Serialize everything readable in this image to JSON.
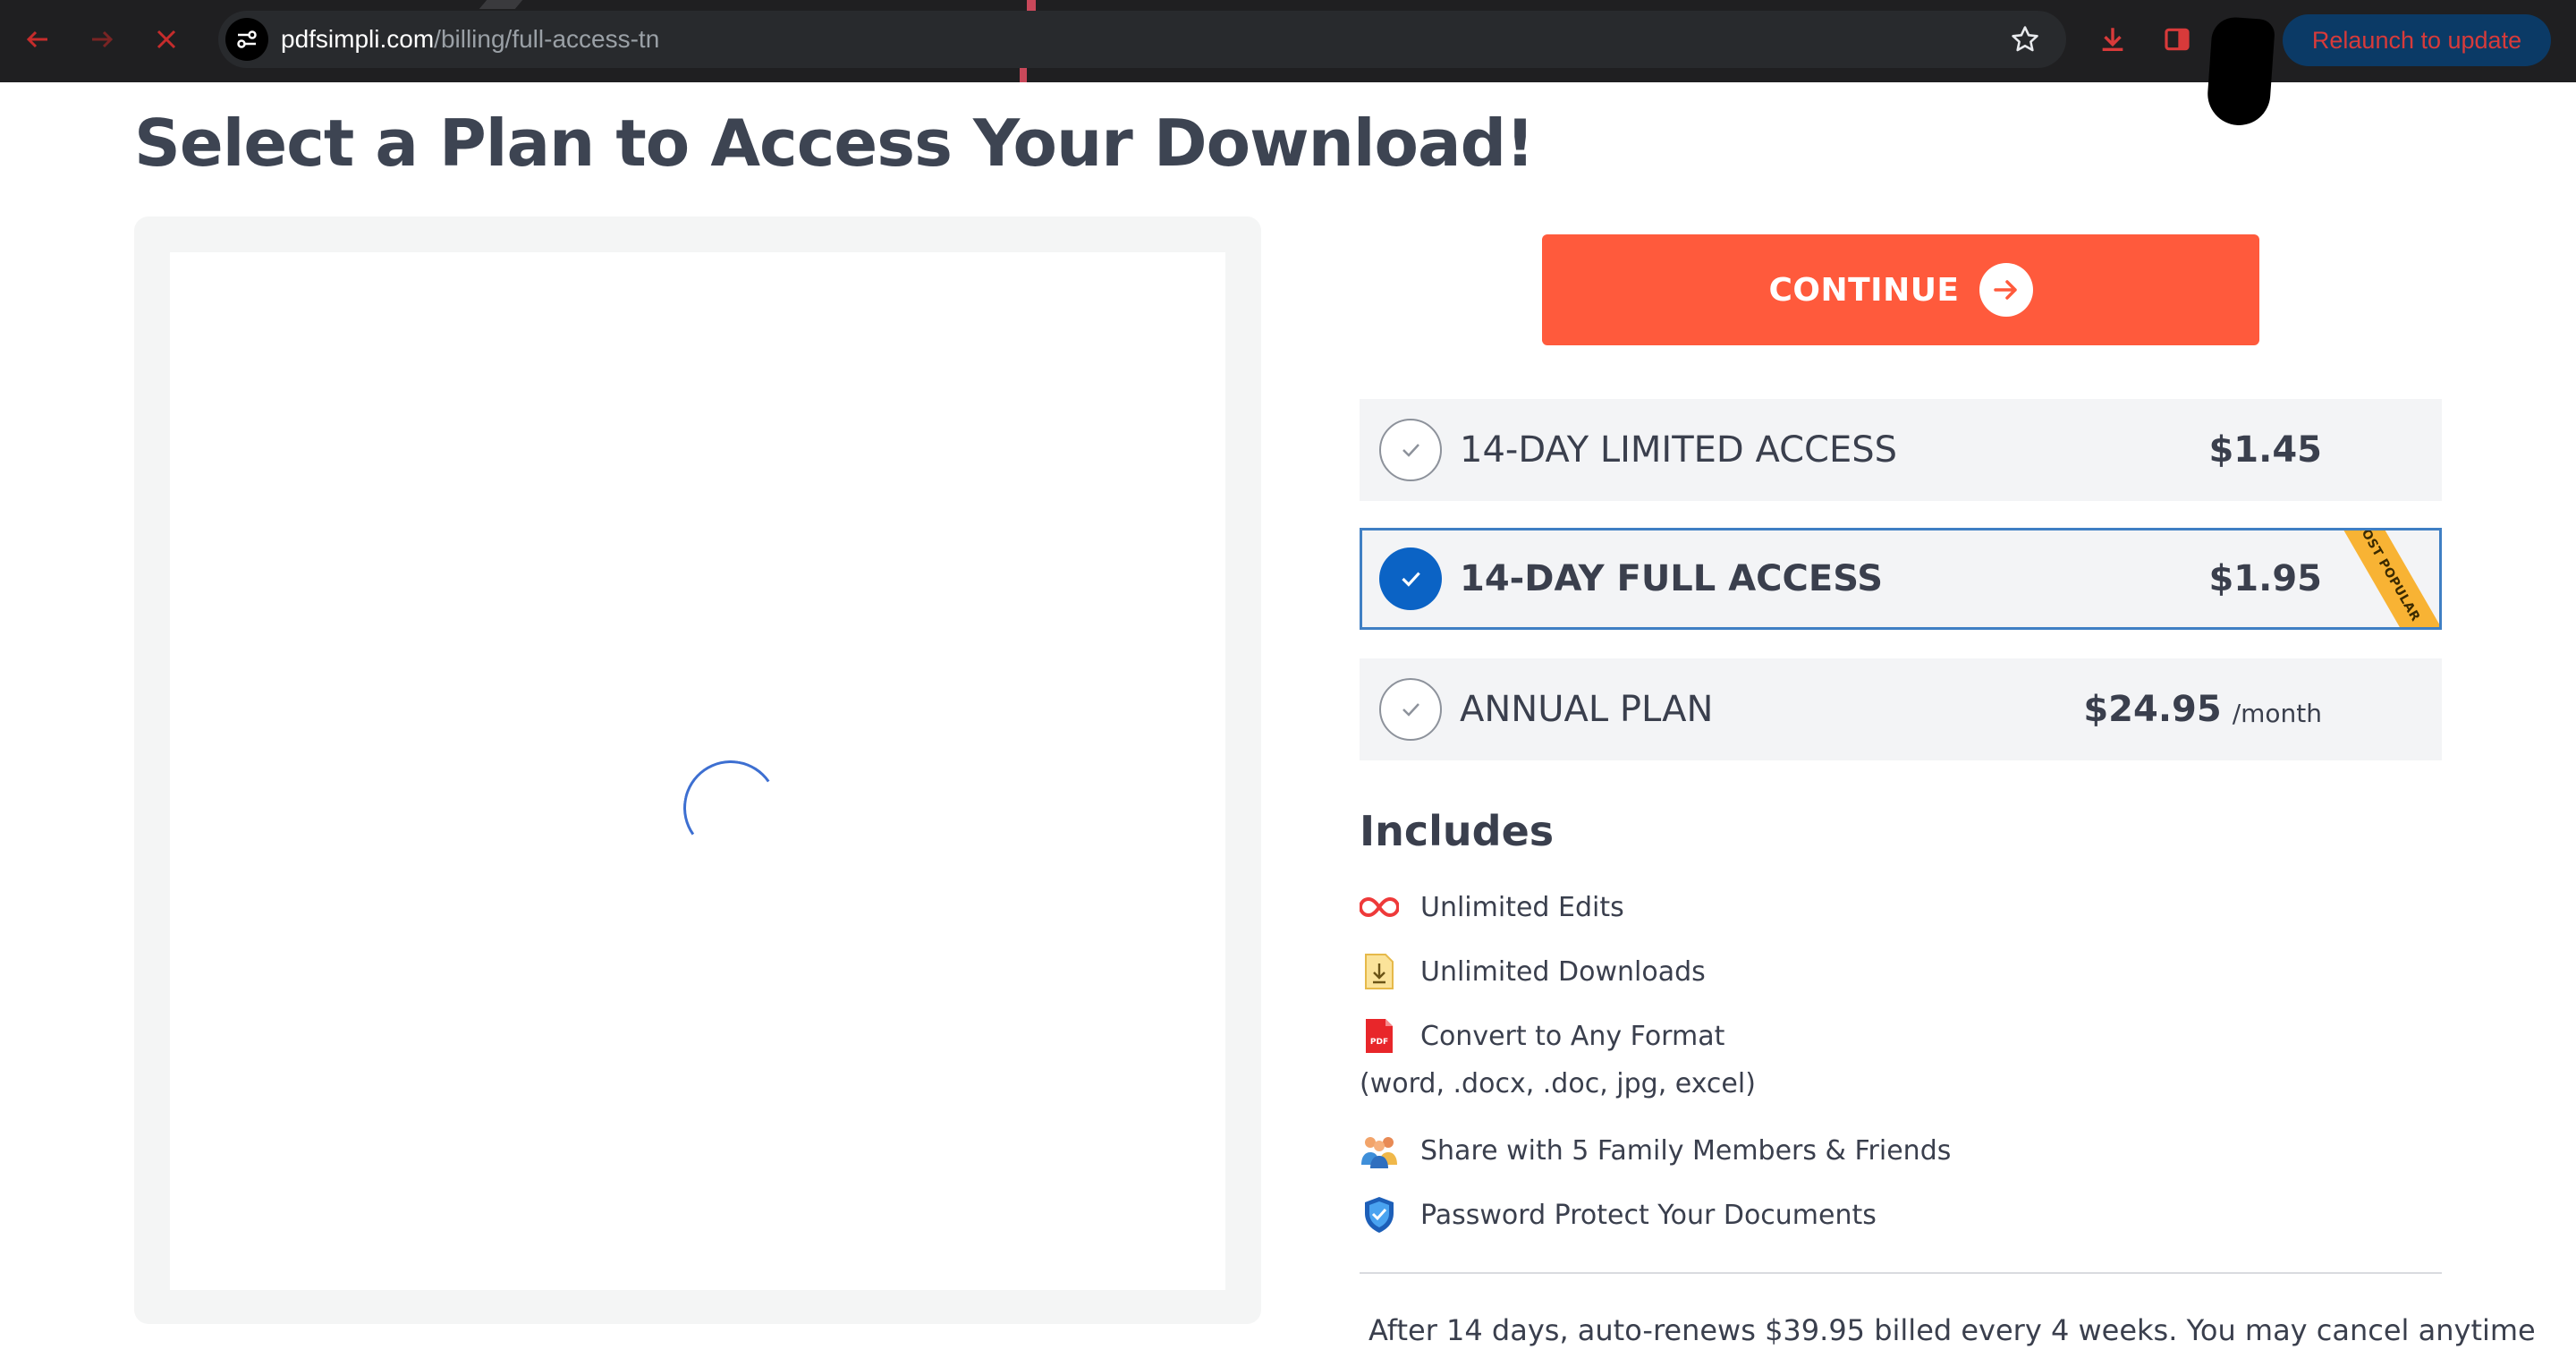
{
  "browser": {
    "url_host": "pdfsimpli.com",
    "url_path": "/billing/full-access-tn",
    "relaunch_label": "Relaunch to update",
    "icons": [
      "back-arrow-icon",
      "forward-arrow-icon",
      "close-icon",
      "site-info-icon",
      "star-icon",
      "download-icon",
      "side-panel-icon"
    ]
  },
  "page": {
    "title": "Select a Plan to Access Your Download!"
  },
  "checkout": {
    "continue_label": "CONTINUE",
    "accent_color": "#ff5a3c",
    "selected_color": "#0b63c5"
  },
  "plans": [
    {
      "name": "14-DAY LIMITED ACCESS",
      "price": "$1.45",
      "per": "",
      "selected": false
    },
    {
      "name": "14-DAY FULL ACCESS",
      "price": "$1.95",
      "per": "",
      "selected": true,
      "badge": "MOST POPULAR"
    },
    {
      "name": "ANNUAL PLAN",
      "price": "$24.95",
      "per": "/month",
      "selected": false
    }
  ],
  "includes": {
    "title": "Includes",
    "items": [
      {
        "icon": "infinity-icon",
        "text": "Unlimited Edits"
      },
      {
        "icon": "download-file-icon",
        "text": "Unlimited Downloads"
      },
      {
        "icon": "pdf-file-icon",
        "text": "Convert to Any Format",
        "sub": "(word, .docx, .doc, jpg, excel)"
      },
      {
        "icon": "people-icon",
        "text": "Share with 5 Family Members & Friends"
      },
      {
        "icon": "shield-icon",
        "text": "Password Protect Your Documents"
      }
    ]
  },
  "footnote": "After 14 days, auto-renews $39.95 billed every 4 weeks. You may cancel anytime"
}
